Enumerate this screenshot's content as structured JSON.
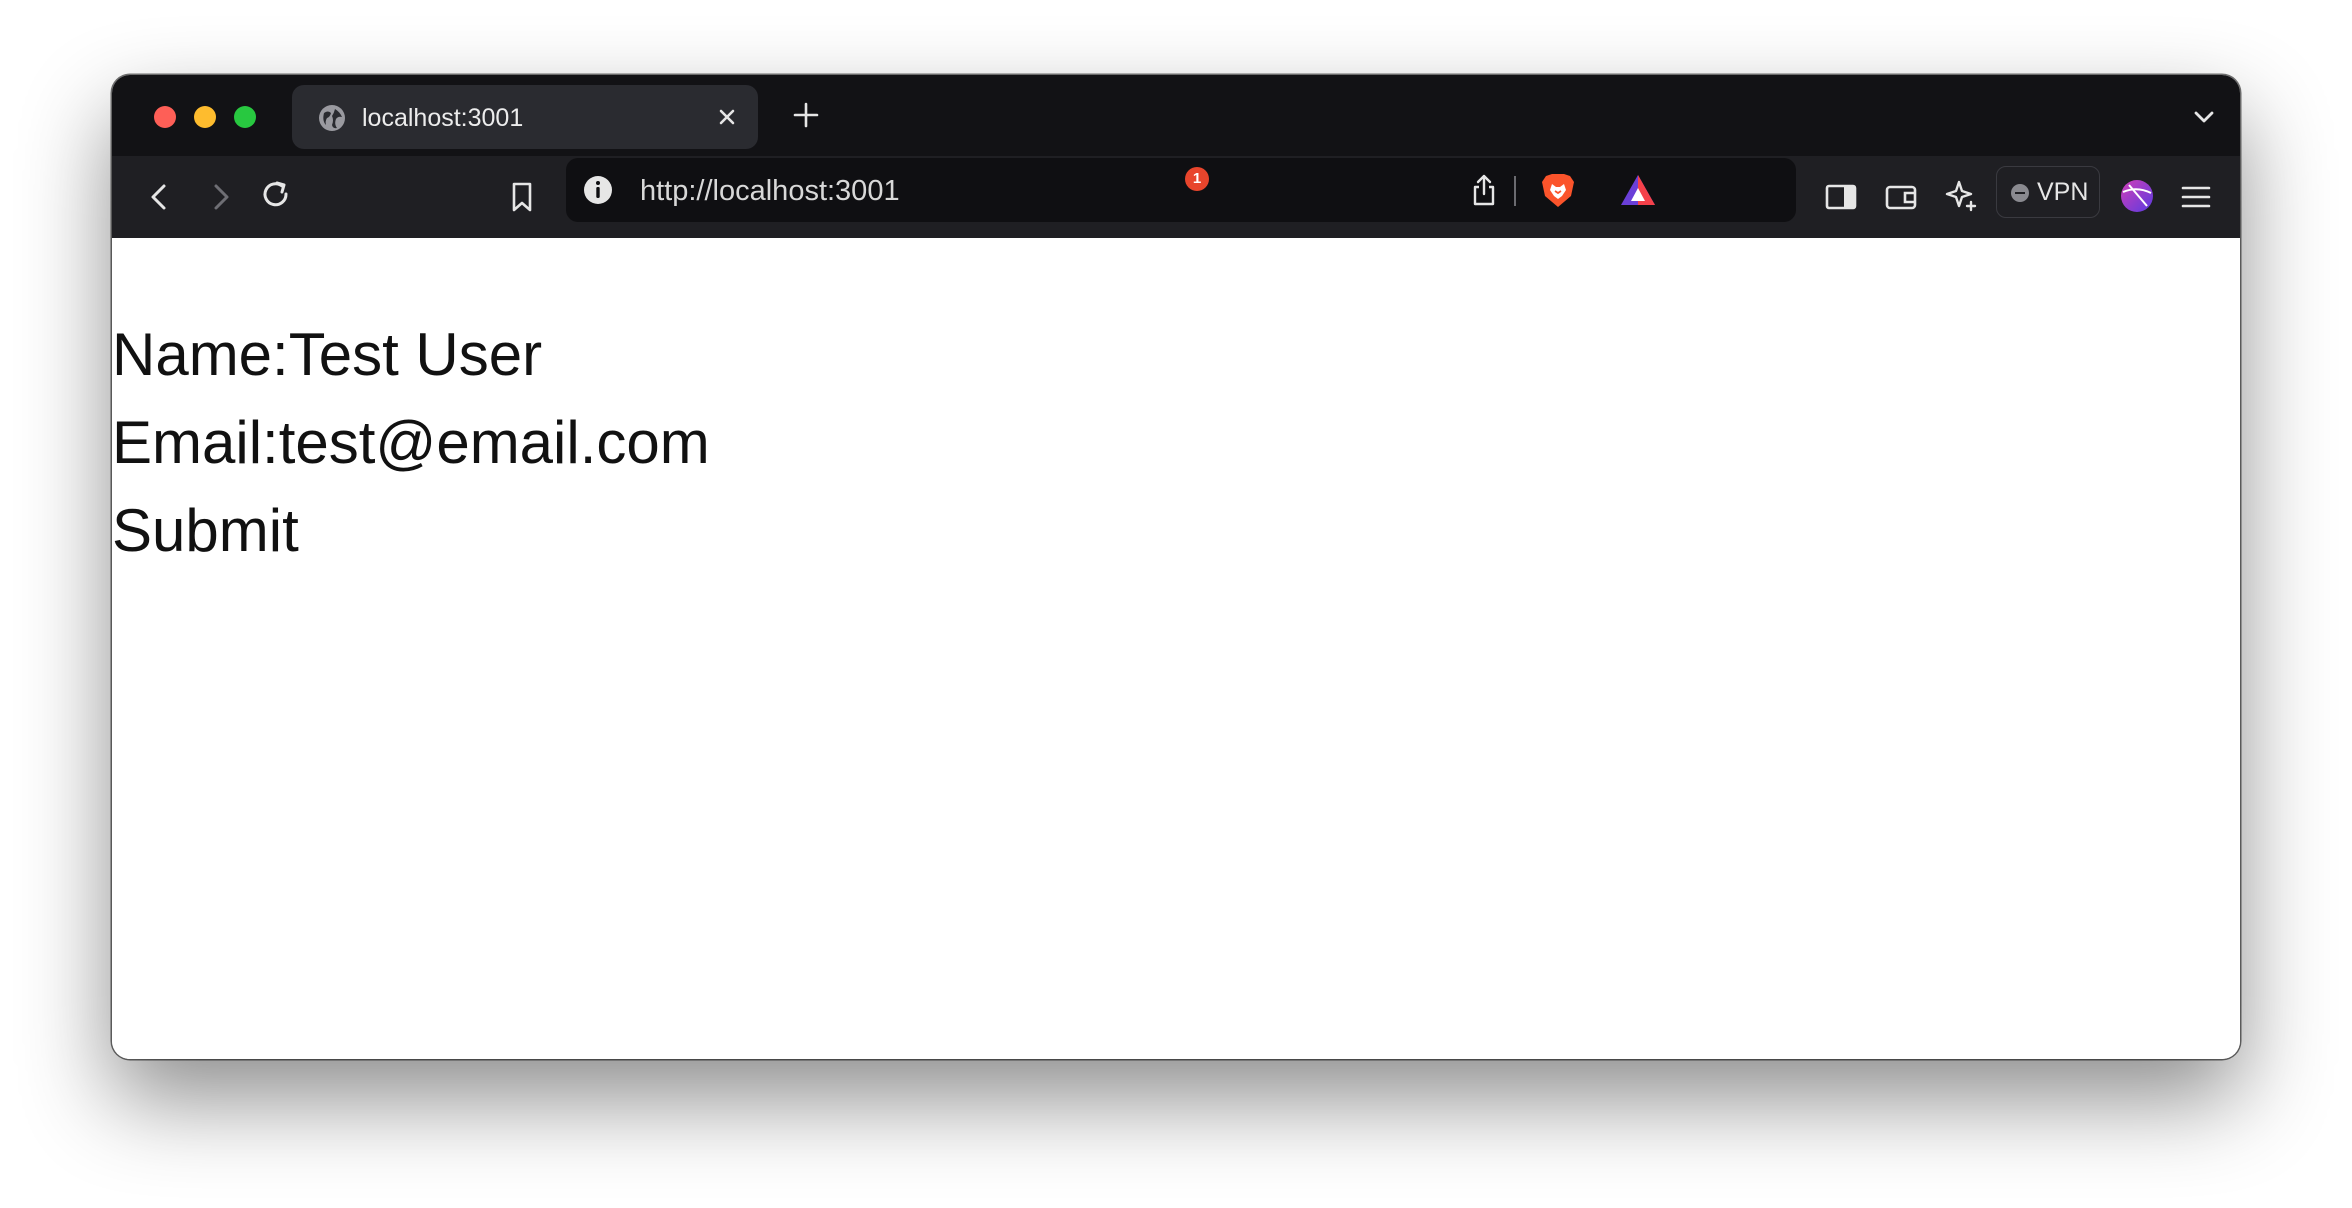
{
  "browser": {
    "tab": {
      "title": "localhost:3001"
    },
    "address_bar": {
      "url": "http://localhost:3001"
    },
    "rewards_badge_count": "1",
    "vpn_label": "VPN"
  },
  "page": {
    "name_label": "Name:",
    "name_value": "Test User",
    "email_label": "Email:",
    "email_value": "test@email.com",
    "submit_label": "Submit"
  },
  "colors": {
    "close": "#fe5f57",
    "minimize": "#febc2e",
    "maximize": "#28c840",
    "brave_orange": "#fb542b",
    "badge_red": "#e8452c"
  },
  "icons": {
    "tab_favicon": "globe-icon",
    "back": "back-arrow-icon",
    "forward": "forward-arrow-icon",
    "reload": "reload-icon",
    "bookmark": "bookmark-icon",
    "site_info": "info-icon",
    "share": "share-icon",
    "brave_shields": "brave-lion-icon",
    "rewards": "rewards-triangle-icon",
    "sidebar": "sidebar-icon",
    "wallet": "wallet-icon",
    "leo": "sparkle-icon",
    "profile": "profile-avatar-icon",
    "menu": "hamburger-menu-icon"
  }
}
